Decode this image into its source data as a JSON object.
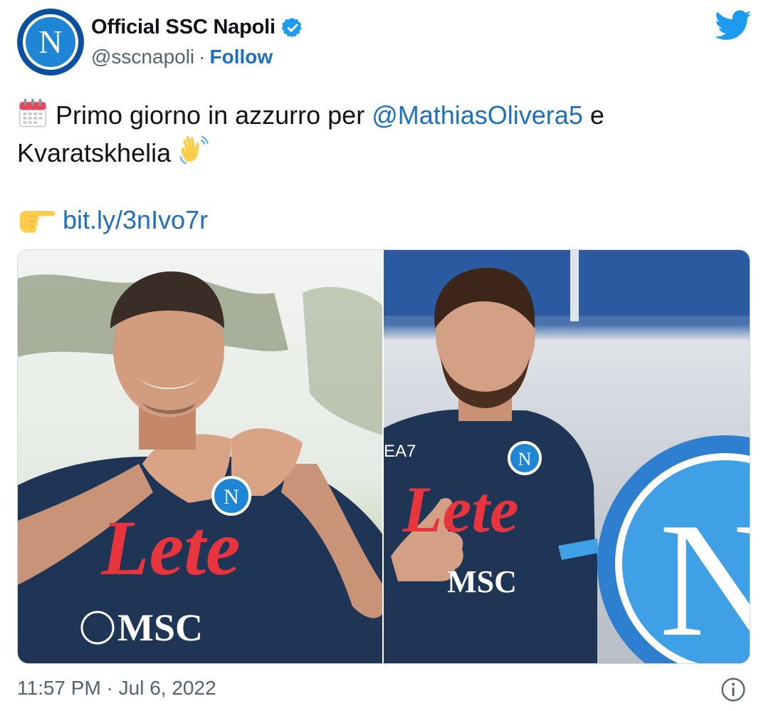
{
  "author": {
    "display_name": "Official SSC Napoli",
    "handle": "@sscnapoli",
    "separator": "·",
    "follow_label": "Follow",
    "avatar_letter": "N",
    "verified_icon": "verified-badge-icon",
    "twitter_icon": "twitter-bird-icon"
  },
  "tweet": {
    "line1_emoji": "calendar-icon",
    "line1_text": "Primo giorno in azzurro per ",
    "mention": "@MathiasOlivera5",
    "line1_suffix": " e",
    "line2_text": "Kvaratskhelia ",
    "line2_emoji": "waving-hand-icon",
    "line3_emoji": "pointing-right-hand-icon",
    "link": "bit.ly/3nIvo7r"
  },
  "media": {
    "photo_left": {
      "jersey_sponsor": "Lete",
      "sponsor_secondary": "MSC",
      "badge_letter": "N"
    },
    "photo_right": {
      "jersey_sponsor": "Lete",
      "sponsor_secondary": "MSC",
      "kit_brand": "EA7",
      "badge_letter": "N",
      "wall_logo_letter": "N"
    }
  },
  "footer": {
    "timestamp": "11:57 PM · Jul 6, 2022",
    "info_icon": "info-icon"
  },
  "colors": {
    "link": "#1d6fc0",
    "verified": "#1d9bf0",
    "twitter": "#1d9bf0",
    "napoli_blue": "#1f86d6",
    "kit_navy": "#1f3556",
    "sponsor_red": "#e8343c"
  }
}
